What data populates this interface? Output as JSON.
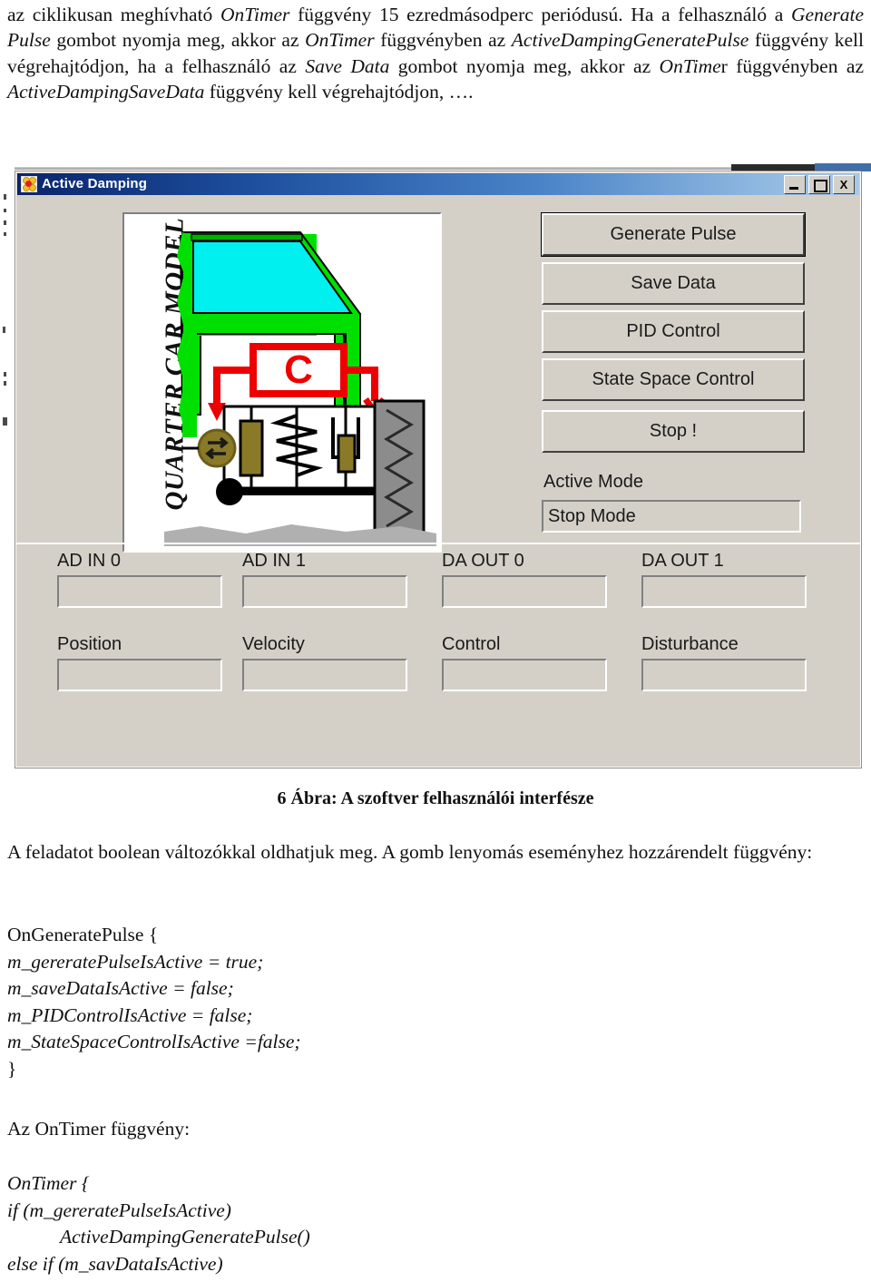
{
  "document": {
    "intro_paragraph": {
      "runs": [
        {
          "t": "az ciklikusan meghívható ",
          "i": false
        },
        {
          "t": "OnTimer",
          "i": true
        },
        {
          "t": " függvény 15 ezredmásodperc periódusú. Ha a felhasználó a ",
          "i": false
        },
        {
          "t": "Generate Pulse",
          "i": true
        },
        {
          "t": " gombot nyomja meg, akkor az ",
          "i": false
        },
        {
          "t": "OnTimer",
          "i": true
        },
        {
          "t": " függvényben az ",
          "i": false
        },
        {
          "t": "ActiveDampingGeneratePulse",
          "i": true
        },
        {
          "t": " függvény kell végrehajtódjon, ha a felhasználó az ",
          "i": false
        },
        {
          "t": "Save Data",
          "i": true
        },
        {
          "t": " gombot nyomja meg, akkor az ",
          "i": false
        },
        {
          "t": "OnTime",
          "i": true
        },
        {
          "t": "r függvényben az ",
          "i": false
        },
        {
          "t": "ActiveDampingSaveData",
          "i": true
        },
        {
          "t": " függvény kell végrehajtódjon, ….",
          "i": false
        }
      ]
    },
    "figure_caption": "6 Ábra: A szoftver felhasználói interfésze",
    "body_paragraph": {
      "runs": [
        {
          "t": "A feladatot boolean változókkal oldhatjuk meg. A gomb lenyomás eseményhez hozzárendelt függvény:",
          "i": false
        }
      ]
    },
    "ontimer_intro": "Az OnTimer függvény:",
    "code_generate_pulse": [
      {
        "text": "OnGeneratePulse {",
        "italic": false,
        "indent": false
      },
      {
        "text": "m_gereratePulseIsActive = true;",
        "italic": true,
        "indent": false
      },
      {
        "text": "m_saveDataIsActive = false;",
        "italic": true,
        "indent": false
      },
      {
        "text": "m_PIDControlIsActive = false;",
        "italic": true,
        "indent": false
      },
      {
        "text": "m_StateSpaceControlIsActive =false;",
        "italic": true,
        "indent": false
      },
      {
        "text": "}",
        "italic": false,
        "indent": false
      }
    ],
    "code_ontimer": [
      {
        "text": "OnTimer {",
        "italic": true,
        "indent": false
      },
      {
        "text": "if (m_gereratePulseIsActive)",
        "italic": true,
        "indent": false
      },
      {
        "text": "ActiveDampingGeneratePulse()",
        "italic": true,
        "indent": true
      },
      {
        "text": "else if (m_savDataIsActive)",
        "italic": true,
        "indent": false
      }
    ]
  },
  "app_window": {
    "title": "Active Damping",
    "icon_name": "flower-app-icon",
    "window_controls": [
      {
        "name": "minimize-button",
        "glyph": ""
      },
      {
        "name": "maximize-button",
        "glyph": ""
      },
      {
        "name": "close-button",
        "glyph": "X"
      }
    ],
    "model_panel": {
      "label": "QUARTER CAR MODEL",
      "controller_box_label": "C"
    },
    "buttons": [
      {
        "id": "generate-pulse",
        "label": "Generate Pulse"
      },
      {
        "id": "save-data",
        "label": "Save Data"
      },
      {
        "id": "pid-control",
        "label": "PID Control"
      },
      {
        "id": "state-space-control",
        "label": "State Space Control"
      },
      {
        "id": "stop",
        "label": "Stop !"
      }
    ],
    "active_mode": {
      "label": "Active Mode",
      "value": "Stop Mode"
    },
    "io_fields": [
      {
        "id": "ad-in-0",
        "label": "AD IN 0",
        "value": "",
        "col": 0,
        "row": 0
      },
      {
        "id": "ad-in-1",
        "label": "AD IN 1",
        "value": "",
        "col": 1,
        "row": 0
      },
      {
        "id": "da-out-0",
        "label": "DA OUT 0",
        "value": "",
        "col": 2,
        "row": 0
      },
      {
        "id": "da-out-1",
        "label": "DA OUT 1",
        "value": "",
        "col": 3,
        "row": 0
      },
      {
        "id": "position",
        "label": "Position",
        "value": "",
        "col": 0,
        "row": 1
      },
      {
        "id": "velocity",
        "label": "Velocity",
        "value": "",
        "col": 1,
        "row": 1
      },
      {
        "id": "control",
        "label": "Control",
        "value": "",
        "col": 2,
        "row": 1
      },
      {
        "id": "disturbance",
        "label": "Disturbance",
        "value": "",
        "col": 3,
        "row": 1
      }
    ]
  },
  "colors": {
    "window_face": "#d4d0c8",
    "titlebar_dark": "#0a246a",
    "titlebar_light": "#a9c8e8",
    "car_body_green": "#00e000",
    "window_glass_cyan": "#00f0f0",
    "controller_red": "#ee0000",
    "tire_gray": "#8c8c8c",
    "actuator_olive": "#8a7a28",
    "road_gray": "#b0b0b0"
  }
}
